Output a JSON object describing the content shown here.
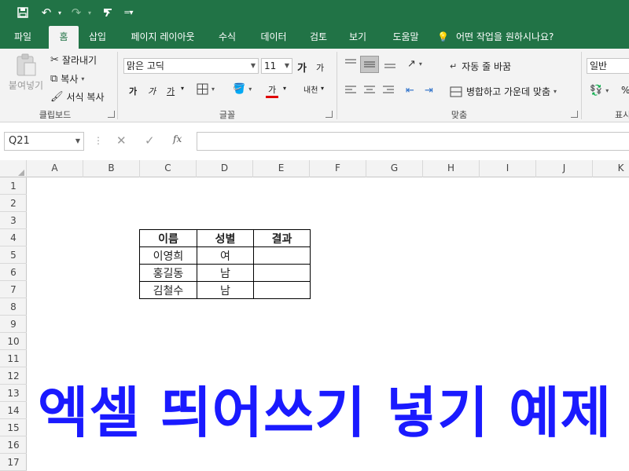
{
  "qat": {
    "save": "save-icon",
    "undo": "undo-icon",
    "redo": "redo-icon",
    "custom": "format-painter-icon",
    "more": "customize-icon"
  },
  "tabs": [
    "파일",
    "홈",
    "삽입",
    "페이지 레이아웃",
    "수식",
    "데이터",
    "검토",
    "보기",
    "도움말"
  ],
  "tell_me": "어떤 작업을 원하시나요?",
  "ribbon": {
    "clipboard": {
      "paste": "붙여넣기",
      "cut": "잘라내기",
      "copy": "복사",
      "format_painter": "서식 복사",
      "label": "클립보드"
    },
    "font": {
      "name": "맑은 고딕",
      "size": "11",
      "grow": "가",
      "shrink": "가",
      "bold": "가",
      "italic": "가",
      "underline": "가",
      "font_color": "가",
      "phonetic": "내천",
      "label": "글꼴"
    },
    "alignment": {
      "wrap": "자동 줄 바꿈",
      "merge": "병합하고 가운데 맞춤",
      "label": "맞춤"
    },
    "number": {
      "format": "일반",
      "label": "표시"
    }
  },
  "formula_bar": {
    "name_box": "Q21",
    "fx": "fx",
    "formula": ""
  },
  "columns": [
    "A",
    "B",
    "C",
    "D",
    "E",
    "F",
    "G",
    "H",
    "I",
    "J",
    "K"
  ],
  "rows": [
    "1",
    "2",
    "3",
    "4",
    "5",
    "6",
    "7",
    "8",
    "9",
    "10",
    "11",
    "12",
    "13",
    "14",
    "15",
    "16",
    "17"
  ],
  "table": {
    "headers": [
      "이름",
      "성별",
      "결과"
    ],
    "rows": [
      [
        "이영희",
        "여",
        ""
      ],
      [
        "홍길동",
        "남",
        ""
      ],
      [
        "김철수",
        "남",
        ""
      ]
    ]
  },
  "overlay_title": "엑셀 띄어쓰기 넣기 예제",
  "colors": {
    "excel_green": "#217346",
    "title_blue": "#1a1aff"
  }
}
